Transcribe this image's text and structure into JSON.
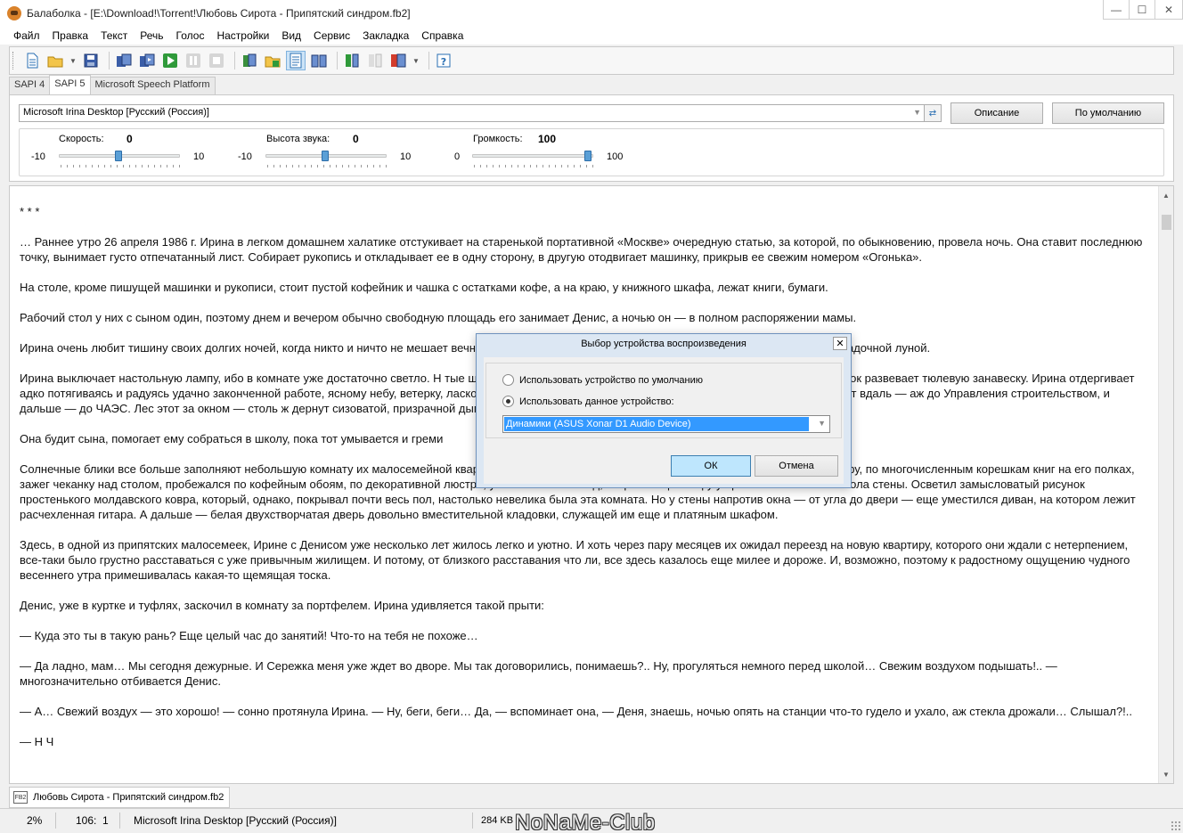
{
  "window": {
    "title": "Балаболка - [E:\\Download!\\Torrent!\\Любовь Сирота - Припятский синдром.fb2]",
    "minimize": "—",
    "maximize": "☐",
    "close": "✕"
  },
  "menu": [
    "Файл",
    "Правка",
    "Текст",
    "Речь",
    "Голос",
    "Настройки",
    "Вид",
    "Сервис",
    "Закладка",
    "Справка"
  ],
  "tabs": [
    {
      "label": "SAPI 4"
    },
    {
      "label": "SAPI 5"
    },
    {
      "label": "Microsoft Speech Platform"
    }
  ],
  "voice": {
    "selected": "Microsoft Irina Desktop [Русский (Россия)]",
    "description_button": "Описание",
    "default_button": "По умолчанию",
    "sliders": {
      "rate": {
        "label": "Скорость:",
        "value": "0",
        "min": "-10",
        "max": "10",
        "position": 0.5
      },
      "pitch": {
        "label": "Высота звука:",
        "value": "0",
        "min": "-10",
        "max": "10",
        "position": 0.5
      },
      "volume": {
        "label": "Громкость:",
        "value": "100",
        "min": "0",
        "max": "100",
        "position": 1.0
      }
    }
  },
  "document": {
    "paragraphs": [
      "* * *",
      "… Раннее утро 26 апреля 1986 г. Ирина в легком домашнем халатике отстукивает на старенькой портативной «Москве» очередную статью, за которой, по обыкновению, провела ночь. Она ставит последнюю точку, вынимает густо отпечатанный лист. Собирает рукопись и откладывает ее в одну сторону, в другую отодвигает машинку, прикрыв ее свежим номером «Огонька».",
      "На столе, кроме пишущей машинки и рукописи, стоит пустой кофейник и чашка с остатками кофе, а на краю, у книжного шкафа, лежат книги, бумаги.",
      "Рабочий стол у них с сыном один, поэтому днем и вечером обычно свободную площадь его занимает Денис, а ночью он — в полном распоряжении мамы.",
      "Ирина очень любит тишину своих долгих ночей, когда никто и ничто не мешает                                                                     вечности наедине со звездами и постоянно изменяющейся, но всегда загадочной луной.",
      "Ирина выключает настольную лампу, ибо в комнате уже достаточно светло. Н                                                                          тые шторы. Крайняя створка распахнута настежь, и легкий весенний ветерок развевает тюлевую занавеску. Ирина отдергивает                                                                   адко потягиваясь и радуясь удачно законченной работе, ясному небу, ветерку, ласково треплющему ее пышные, длинные свет                                                                    плотными соснами убегает вдаль — аж до Управления строительством, и дальше — до ЧАЭС. Лес этот за окном — столь ж                                                                    дернут сизоватой, призрачной дымкой. Хорошо!..",
      "Она будит сына, помогает ему собраться в школу, пока тот умывается и греми",
      "Солнечные блики все больше заполняют небольшую комнату их малосемейной квартиры. Вот луч заиграл по инкрустированным часам на книжном шкафу, по многочисленным корешкам книг на его полках, зажег чеканку над столом, пробежался по кофейным обоям, по декоративной люстре, упал на мягкий плед, покрывающий софу у противоположной от стола стены. Осветил замысловатый рисунок простенького молдавского ковра, который, однако, покрывал почти весь пол, настолько невелика была эта комната. Но у стены напротив окна — от угла до двери — еще уместился диван, на котором лежит расчехленная гитара. А дальше — белая двухстворчатая дверь довольно вместительной кладовки, служащей им еще и платяным шкафом.",
      "Здесь, в одной из припятских малосемеек, Ирине с Денисом уже несколько лет жилось легко и уютно. И хоть через пару месяцев их ожидал переезд на новую квартиру, которого они ждали с нетерпением, все-таки было грустно расставаться с уже привычным жилищем. И потому, от близкого расставания что ли, все здесь казалось еще милее и дороже. И, возможно, поэтому к радостному ощущению чудного весеннего утра примешивалась какая-то щемящая тоска.",
      "Денис, уже в куртке и туфлях, заскочил в комнату за портфелем. Ирина удивляется такой прыти:",
      "— Куда это ты в такую рань? Еще целый час до занятий! Что-то на тебя не похоже…",
      "— Да ладно, мам… Мы сегодня дежурные. И Сережка меня уже ждет во дворе. Мы так договорились, понимаешь?.. Ну, прогуляться немного перед школой… Свежим воздухом подышать!.. — многозначительно отбивается Денис.",
      "— А… Свежий воздух — это хорошо! — сонно протянула Ирина. — Ну, беги, беги… Да, — вспоминает она, — Деня, знаешь, ночью опять на станции что-то гудело и ухало, аж стекла дрожали… Слышал?!..",
      "— Н                                    Ч"
    ]
  },
  "doc_tab": {
    "icon": "FB2",
    "label": "Любовь Сирота - Припятский синдром.fb2"
  },
  "status": {
    "percent": "2%",
    "position": "106:  1",
    "voice": "Microsoft Irina Desktop [Русский (Россия)]",
    "size": "284 KB",
    "watermark": "NoNaMe-Club"
  },
  "dialog": {
    "title": "Выбор устройства воспроизведения",
    "close": "✕",
    "option_default": "Использовать устройство по умолчанию",
    "option_device": "Использовать данное устройство:",
    "selected_option": "device",
    "device": "Динамики (ASUS Xonar D1 Audio Device)",
    "ok": "ОК",
    "cancel": "Отмена"
  },
  "colors": {
    "accent": "#3399ff",
    "dialog_frame": "#dce7f3",
    "slider_thumb": "#5a9fd6"
  }
}
